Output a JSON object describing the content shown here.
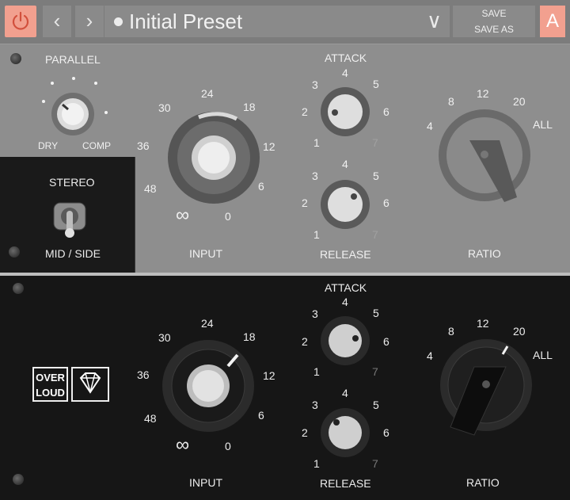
{
  "topbar": {
    "preset_name": "Initial Preset",
    "prev_label": "‹",
    "next_label": "›",
    "dropdown_label": "∨",
    "save_label": "SAVE",
    "save_as_label": "SAVE AS",
    "ab_label": "A",
    "accent": "#f2a08f"
  },
  "upper": {
    "parallel": {
      "title": "PARALLEL",
      "dry": "DRY",
      "comp": "COMP"
    },
    "stereo": {
      "title": "STEREO",
      "mode": "MID / SIDE"
    },
    "input": {
      "label": "INPUT",
      "ticks": [
        "∞",
        "48",
        "36",
        "30",
        "24",
        "18",
        "12",
        "6",
        "0"
      ]
    },
    "attack": {
      "label": "ATTACK",
      "ticks": [
        "1",
        "2",
        "3",
        "4",
        "5",
        "6",
        "7"
      ]
    },
    "release": {
      "label": "RELEASE",
      "ticks": [
        "1",
        "2",
        "3",
        "4",
        "5",
        "6",
        "7"
      ]
    },
    "ratio": {
      "label": "RATIO",
      "ticks": [
        "4",
        "8",
        "12",
        "20",
        "ALL"
      ]
    }
  },
  "lower": {
    "input": {
      "label": "INPUT",
      "ticks": [
        "∞",
        "48",
        "36",
        "30",
        "24",
        "18",
        "12",
        "6",
        "0"
      ]
    },
    "attack": {
      "label": "ATTACK",
      "ticks": [
        "1",
        "2",
        "3",
        "4",
        "5",
        "6",
        "7"
      ]
    },
    "release": {
      "label": "RELEASE",
      "ticks": [
        "1",
        "2",
        "3",
        "4",
        "5",
        "6",
        "7"
      ]
    },
    "ratio": {
      "label": "RATIO",
      "ticks": [
        "4",
        "8",
        "12",
        "20",
        "ALL"
      ]
    },
    "logo": {
      "line1": "OVER",
      "line2": "LOUD"
    }
  }
}
